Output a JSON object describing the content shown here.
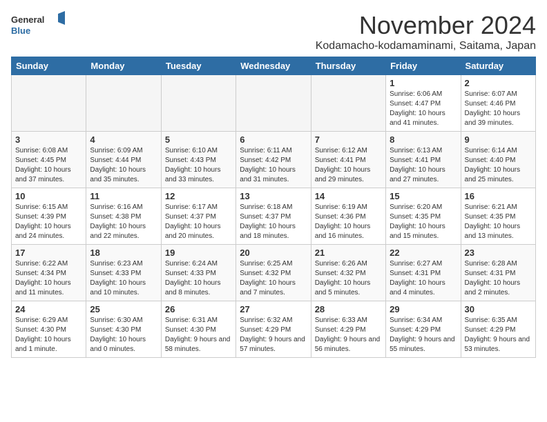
{
  "header": {
    "logo_line1": "General",
    "logo_line2": "Blue",
    "title": "November 2024",
    "subtitle": "Kodamacho-kodamaminami, Saitama, Japan"
  },
  "weekdays": [
    "Sunday",
    "Monday",
    "Tuesday",
    "Wednesday",
    "Thursday",
    "Friday",
    "Saturday"
  ],
  "weeks": [
    [
      {
        "day": "",
        "info": ""
      },
      {
        "day": "",
        "info": ""
      },
      {
        "day": "",
        "info": ""
      },
      {
        "day": "",
        "info": ""
      },
      {
        "day": "",
        "info": ""
      },
      {
        "day": "1",
        "info": "Sunrise: 6:06 AM\nSunset: 4:47 PM\nDaylight: 10 hours and 41 minutes."
      },
      {
        "day": "2",
        "info": "Sunrise: 6:07 AM\nSunset: 4:46 PM\nDaylight: 10 hours and 39 minutes."
      }
    ],
    [
      {
        "day": "3",
        "info": "Sunrise: 6:08 AM\nSunset: 4:45 PM\nDaylight: 10 hours and 37 minutes."
      },
      {
        "day": "4",
        "info": "Sunrise: 6:09 AM\nSunset: 4:44 PM\nDaylight: 10 hours and 35 minutes."
      },
      {
        "day": "5",
        "info": "Sunrise: 6:10 AM\nSunset: 4:43 PM\nDaylight: 10 hours and 33 minutes."
      },
      {
        "day": "6",
        "info": "Sunrise: 6:11 AM\nSunset: 4:42 PM\nDaylight: 10 hours and 31 minutes."
      },
      {
        "day": "7",
        "info": "Sunrise: 6:12 AM\nSunset: 4:41 PM\nDaylight: 10 hours and 29 minutes."
      },
      {
        "day": "8",
        "info": "Sunrise: 6:13 AM\nSunset: 4:41 PM\nDaylight: 10 hours and 27 minutes."
      },
      {
        "day": "9",
        "info": "Sunrise: 6:14 AM\nSunset: 4:40 PM\nDaylight: 10 hours and 25 minutes."
      }
    ],
    [
      {
        "day": "10",
        "info": "Sunrise: 6:15 AM\nSunset: 4:39 PM\nDaylight: 10 hours and 24 minutes."
      },
      {
        "day": "11",
        "info": "Sunrise: 6:16 AM\nSunset: 4:38 PM\nDaylight: 10 hours and 22 minutes."
      },
      {
        "day": "12",
        "info": "Sunrise: 6:17 AM\nSunset: 4:37 PM\nDaylight: 10 hours and 20 minutes."
      },
      {
        "day": "13",
        "info": "Sunrise: 6:18 AM\nSunset: 4:37 PM\nDaylight: 10 hours and 18 minutes."
      },
      {
        "day": "14",
        "info": "Sunrise: 6:19 AM\nSunset: 4:36 PM\nDaylight: 10 hours and 16 minutes."
      },
      {
        "day": "15",
        "info": "Sunrise: 6:20 AM\nSunset: 4:35 PM\nDaylight: 10 hours and 15 minutes."
      },
      {
        "day": "16",
        "info": "Sunrise: 6:21 AM\nSunset: 4:35 PM\nDaylight: 10 hours and 13 minutes."
      }
    ],
    [
      {
        "day": "17",
        "info": "Sunrise: 6:22 AM\nSunset: 4:34 PM\nDaylight: 10 hours and 11 minutes."
      },
      {
        "day": "18",
        "info": "Sunrise: 6:23 AM\nSunset: 4:33 PM\nDaylight: 10 hours and 10 minutes."
      },
      {
        "day": "19",
        "info": "Sunrise: 6:24 AM\nSunset: 4:33 PM\nDaylight: 10 hours and 8 minutes."
      },
      {
        "day": "20",
        "info": "Sunrise: 6:25 AM\nSunset: 4:32 PM\nDaylight: 10 hours and 7 minutes."
      },
      {
        "day": "21",
        "info": "Sunrise: 6:26 AM\nSunset: 4:32 PM\nDaylight: 10 hours and 5 minutes."
      },
      {
        "day": "22",
        "info": "Sunrise: 6:27 AM\nSunset: 4:31 PM\nDaylight: 10 hours and 4 minutes."
      },
      {
        "day": "23",
        "info": "Sunrise: 6:28 AM\nSunset: 4:31 PM\nDaylight: 10 hours and 2 minutes."
      }
    ],
    [
      {
        "day": "24",
        "info": "Sunrise: 6:29 AM\nSunset: 4:30 PM\nDaylight: 10 hours and 1 minute."
      },
      {
        "day": "25",
        "info": "Sunrise: 6:30 AM\nSunset: 4:30 PM\nDaylight: 10 hours and 0 minutes."
      },
      {
        "day": "26",
        "info": "Sunrise: 6:31 AM\nSunset: 4:30 PM\nDaylight: 9 hours and 58 minutes."
      },
      {
        "day": "27",
        "info": "Sunrise: 6:32 AM\nSunset: 4:29 PM\nDaylight: 9 hours and 57 minutes."
      },
      {
        "day": "28",
        "info": "Sunrise: 6:33 AM\nSunset: 4:29 PM\nDaylight: 9 hours and 56 minutes."
      },
      {
        "day": "29",
        "info": "Sunrise: 6:34 AM\nSunset: 4:29 PM\nDaylight: 9 hours and 55 minutes."
      },
      {
        "day": "30",
        "info": "Sunrise: 6:35 AM\nSunset: 4:29 PM\nDaylight: 9 hours and 53 minutes."
      }
    ]
  ]
}
